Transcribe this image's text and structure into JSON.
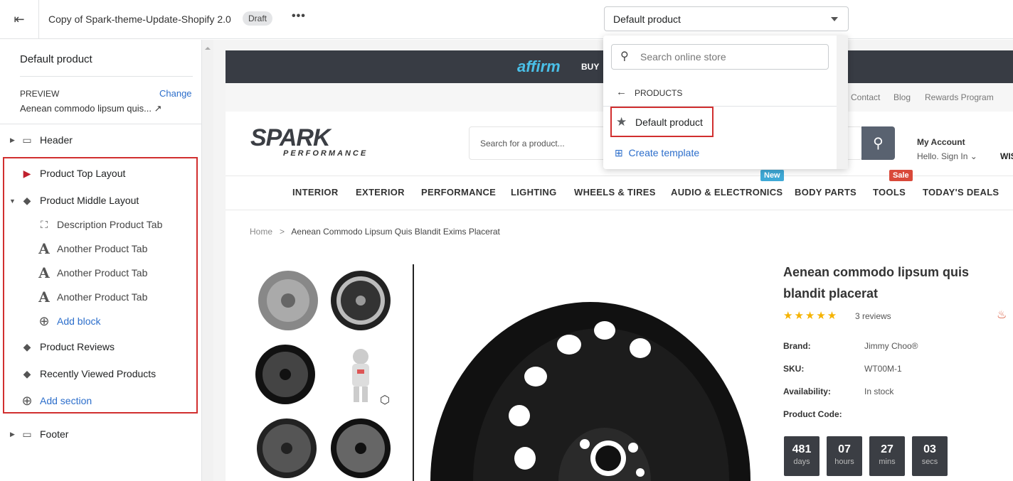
{
  "topbar": {
    "title": "Copy of Spark-theme-Update-Shopify 2.0",
    "status": "Draft",
    "more": "•••",
    "template_select": "Default product"
  },
  "sidebar": {
    "title": "Default product",
    "preview_label": "PREVIEW",
    "change": "Change",
    "preview_item": "Aenean commodo lipsum quis...",
    "sections": {
      "header": "Header",
      "top": "Product Top Layout",
      "middle": "Product Middle Layout",
      "blocks": [
        "Description Product Tab",
        "Another Product Tab",
        "Another Product Tab",
        "Another Product Tab"
      ],
      "add_block": "Add block",
      "reviews": "Product Reviews",
      "recent": "Recently Viewed Products",
      "add_section": "Add section",
      "footer": "Footer"
    }
  },
  "popover": {
    "search_placeholder": "Search online store",
    "back_label": "PRODUCTS",
    "selected": "Default product",
    "create": "Create template"
  },
  "store": {
    "affirm": "affirm",
    "buy": "BUY",
    "utility": [
      "Contact",
      "Blog",
      "Rewards Program"
    ],
    "logo_text": "SPARK",
    "logo_sub": "PERFORMANCE",
    "search_placeholder": "Search for a product...",
    "account": "My Account",
    "signin": "Hello. Sign In",
    "wish": "WIS",
    "nav": [
      "INTERIOR",
      "EXTERIOR",
      "PERFORMANCE",
      "LIGHTING",
      "WHEELS & TIRES",
      "AUDIO & ELECTRONICS",
      "BODY PARTS",
      "TOOLS",
      "TODAY'S DEALS"
    ],
    "badge_new": "New",
    "badge_sale": "Sale",
    "breadcrumb": {
      "home": "Home",
      "sep": ">",
      "current": "Aenean Commodo Lipsum Quis Blandit Exims Placerat"
    },
    "product": {
      "title": "Aenean commodo lipsum quis blandit placerat",
      "rating": 5,
      "reviews": "3 reviews",
      "brand_label": "Brand:",
      "brand": "Jimmy Choo®",
      "sku_label": "SKU:",
      "sku": "WT00M-1",
      "avail_label": "Availability:",
      "avail": "In stock",
      "code_label": "Product Code:",
      "countdown": [
        {
          "n": "481",
          "u": "days"
        },
        {
          "n": "07",
          "u": "hours"
        },
        {
          "n": "27",
          "u": "mins"
        },
        {
          "n": "03",
          "u": "secs"
        }
      ]
    }
  },
  "colors": {
    "accent": "#2c6ecb",
    "highlight": "#d12f2f",
    "promo": "#383c44",
    "new": "#3fa9d6",
    "sale": "#d9493a"
  }
}
